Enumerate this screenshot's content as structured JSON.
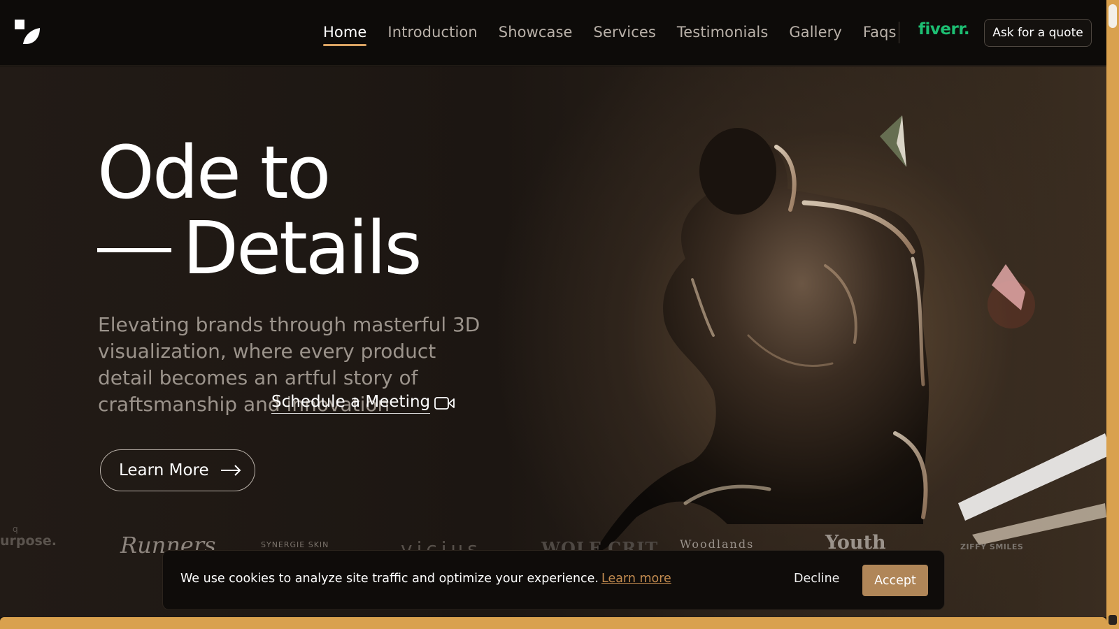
{
  "nav": {
    "items": [
      {
        "label": "Home",
        "active": true
      },
      {
        "label": "Introduction"
      },
      {
        "label": "Showcase"
      },
      {
        "label": "Services"
      },
      {
        "label": "Testimonials"
      },
      {
        "label": "Gallery"
      },
      {
        "label": "Faqs"
      }
    ],
    "fiverr_label": "fiverr.",
    "quote_button": "Ask for a quote"
  },
  "hero": {
    "title_line1": "Ode to",
    "title_line2": "Details",
    "description": "Elevating brands through masterful 3D visualization, where every product detail becomes an artful story of craftsmanship and innovation",
    "learn_more": "Learn More",
    "schedule": "Schedule a Meeting"
  },
  "brands": {
    "purpose_mark": "q",
    "purpose": "urpose.",
    "runners": "Runners",
    "synergie": "SYNERGIE SKIN",
    "vicius": "vicius",
    "wolf": "WOLF CRIT",
    "woodlands": "Woodlands",
    "youth": "Youth",
    "ziffy": "ZIFFY SMILES"
  },
  "cookie": {
    "text": "We use cookies to analyze site traffic and optimize your experience.",
    "link": "Learn more",
    "decline": "Decline",
    "accept": "Accept"
  },
  "colors": {
    "accent": "#d9a14e",
    "fiverr_green": "#1dbf73",
    "accept_button": "#b08658",
    "link": "#c48c50"
  },
  "icons": [
    "logo-icon",
    "arrow-right-icon",
    "video-camera-icon"
  ]
}
